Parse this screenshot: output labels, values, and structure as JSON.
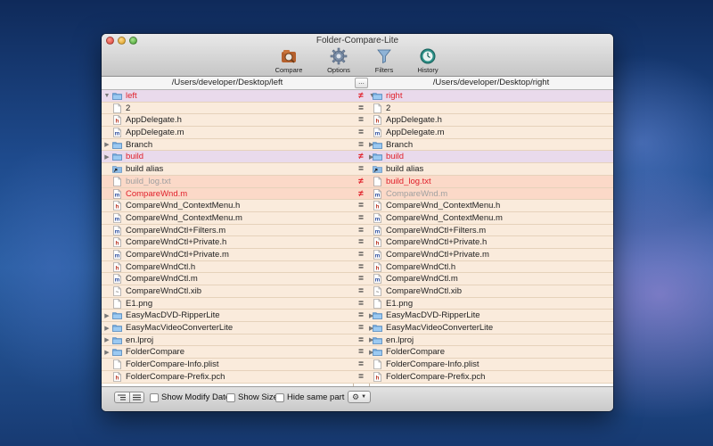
{
  "window": {
    "title": "Folder-Compare-Lite"
  },
  "toolbar": {
    "compare_label": "Compare",
    "options_label": "Options",
    "filters_label": "Filters",
    "history_label": "History"
  },
  "paths": {
    "left": "/Users/developer/Desktop/left",
    "browse_label": "...",
    "right": "/Users/developer/Desktop/right"
  },
  "rows": [
    {
      "expander": "open",
      "icon": "folder-icon",
      "left": "left",
      "right": "right",
      "status": "≠",
      "state": "diffdir",
      "leftStyle": "red",
      "rightStyle": "red"
    },
    {
      "expander": "",
      "icon": "document-icon",
      "left": "2",
      "right": "2",
      "status": "=",
      "state": "same",
      "leftStyle": "",
      "rightStyle": ""
    },
    {
      "expander": "",
      "icon": "header-file-icon",
      "left": "AppDelegate.h",
      "right": "AppDelegate.h",
      "status": "=",
      "state": "same",
      "leftStyle": "",
      "rightStyle": ""
    },
    {
      "expander": "",
      "icon": "source-file-icon",
      "left": "AppDelegate.m",
      "right": "AppDelegate.m",
      "status": "=",
      "state": "same",
      "leftStyle": "",
      "rightStyle": ""
    },
    {
      "expander": "closed",
      "icon": "folder-icon",
      "left": "Branch",
      "right": "Branch",
      "status": "=",
      "state": "same",
      "leftStyle": "",
      "rightStyle": ""
    },
    {
      "expander": "closed",
      "icon": "folder-icon",
      "left": "build",
      "right": "build",
      "status": "≠",
      "state": "diffdir",
      "leftStyle": "red",
      "rightStyle": "red"
    },
    {
      "expander": "",
      "icon": "alias-icon",
      "left": "build alias",
      "right": "build alias",
      "status": "=",
      "state": "same",
      "leftStyle": "",
      "rightStyle": ""
    },
    {
      "expander": "",
      "icon": "document-icon",
      "left": "build_log.txt",
      "right": "build_log.txt",
      "status": "≠",
      "state": "diff",
      "leftStyle": "gray",
      "rightStyle": "red"
    },
    {
      "expander": "",
      "icon": "source-file-icon",
      "left": "CompareWnd.m",
      "right": "CompareWnd.m",
      "status": "≠",
      "state": "diff",
      "leftStyle": "red",
      "rightStyle": "gray"
    },
    {
      "expander": "",
      "icon": "header-file-icon",
      "left": "CompareWnd_ContextMenu.h",
      "right": "CompareWnd_ContextMenu.h",
      "status": "=",
      "state": "same",
      "leftStyle": "",
      "rightStyle": ""
    },
    {
      "expander": "",
      "icon": "source-file-icon",
      "left": "CompareWnd_ContextMenu.m",
      "right": "CompareWnd_ContextMenu.m",
      "status": "=",
      "state": "same",
      "leftStyle": "",
      "rightStyle": ""
    },
    {
      "expander": "",
      "icon": "source-file-icon",
      "left": "CompareWndCtl+Filters.m",
      "right": "CompareWndCtl+Filters.m",
      "status": "=",
      "state": "same",
      "leftStyle": "",
      "rightStyle": ""
    },
    {
      "expander": "",
      "icon": "header-file-icon",
      "left": "CompareWndCtl+Private.h",
      "right": "CompareWndCtl+Private.h",
      "status": "=",
      "state": "same",
      "leftStyle": "",
      "rightStyle": ""
    },
    {
      "expander": "",
      "icon": "source-file-icon",
      "left": "CompareWndCtl+Private.m",
      "right": "CompareWndCtl+Private.m",
      "status": "=",
      "state": "same",
      "leftStyle": "",
      "rightStyle": ""
    },
    {
      "expander": "",
      "icon": "header-file-icon",
      "left": "CompareWndCtl.h",
      "right": "CompareWndCtl.h",
      "status": "=",
      "state": "same",
      "leftStyle": "",
      "rightStyle": ""
    },
    {
      "expander": "",
      "icon": "source-file-icon",
      "left": "CompareWndCtl.m",
      "right": "CompareWndCtl.m",
      "status": "=",
      "state": "same",
      "leftStyle": "",
      "rightStyle": ""
    },
    {
      "expander": "",
      "icon": "xib-file-icon",
      "left": "CompareWndCtl.xib",
      "right": "CompareWndCtl.xib",
      "status": "=",
      "state": "same",
      "leftStyle": "",
      "rightStyle": ""
    },
    {
      "expander": "",
      "icon": "document-icon",
      "left": "E1.png",
      "right": "E1.png",
      "status": "=",
      "state": "same",
      "leftStyle": "",
      "rightStyle": ""
    },
    {
      "expander": "closed",
      "icon": "folder-icon",
      "left": "EasyMacDVD-RipperLite",
      "right": "EasyMacDVD-RipperLite",
      "status": "=",
      "state": "same",
      "leftStyle": "",
      "rightStyle": ""
    },
    {
      "expander": "closed",
      "icon": "folder-icon",
      "left": "EasyMacVideoConverterLite",
      "right": "EasyMacVideoConverterLite",
      "status": "=",
      "state": "same",
      "leftStyle": "",
      "rightStyle": ""
    },
    {
      "expander": "closed",
      "icon": "folder-icon",
      "left": "en.lproj",
      "right": "en.lproj",
      "status": "=",
      "state": "same",
      "leftStyle": "",
      "rightStyle": ""
    },
    {
      "expander": "closed",
      "icon": "folder-icon",
      "left": "FolderCompare",
      "right": "FolderCompare",
      "status": "=",
      "state": "same",
      "leftStyle": "",
      "rightStyle": ""
    },
    {
      "expander": "",
      "icon": "document-icon",
      "left": "FolderCompare-Info.plist",
      "right": "FolderCompare-Info.plist",
      "status": "=",
      "state": "same",
      "leftStyle": "",
      "rightStyle": ""
    },
    {
      "expander": "",
      "icon": "header-file-icon",
      "left": "FolderCompare-Prefix.pch",
      "right": "FolderCompare-Prefix.pch",
      "status": "=",
      "state": "same",
      "leftStyle": "",
      "rightStyle": ""
    }
  ],
  "bottom": {
    "show_modify_date": "Show Modify Date",
    "show_size": "Show Size",
    "hide_same_part": "Hide same part"
  },
  "colors": {
    "same_row": "#faebdc",
    "different_folder_row": "#e9daec",
    "different_file_row": "#fbd9c8",
    "different_text": "#e0202a"
  }
}
